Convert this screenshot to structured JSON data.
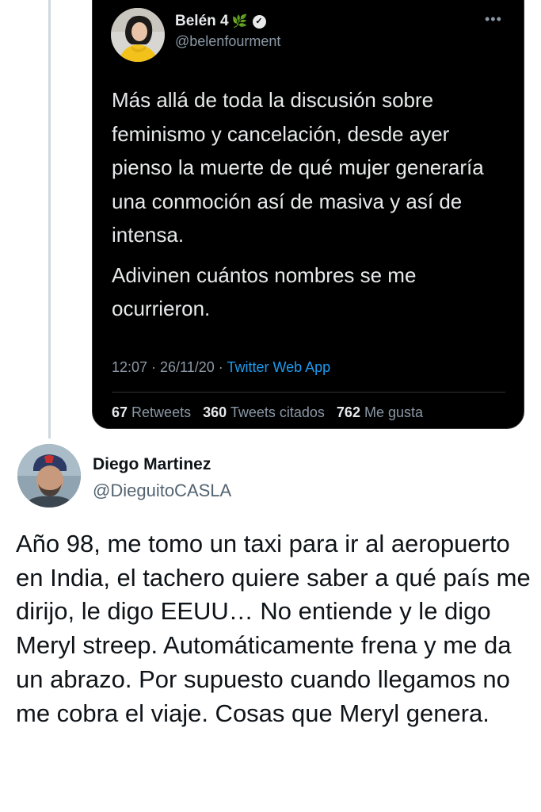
{
  "quoted_tweet": {
    "author_name": "Belén 4",
    "name_emoji": "🌿",
    "verified_icon": "verified-badge-icon",
    "handle": "@belenfourment",
    "more_icon": "•••",
    "paragraphs": [
      "Más allá de toda la discusión sobre feminismo y cancelación, desde ayer pienso la muerte de qué mujer generaría una conmoción así de masiva y así de intensa.",
      "Adivinen cuántos nombres se me ocurrieron."
    ],
    "time": "12:07 · 26/11/20 · ",
    "source": "Twitter Web App",
    "stats": {
      "retweets_count": "67",
      "retweets_label": "Retweets",
      "quotes_count": "360",
      "quotes_label": "Tweets citados",
      "likes_count": "762",
      "likes_label": "Me gusta"
    }
  },
  "tweet": {
    "author_name": "Diego Martinez",
    "handle": "@DieguitoCASLA",
    "text": "Año 98, me tomo un taxi para ir al aeropuerto en India, el tachero quiere saber a qué país me dirijo, le digo EEUU… No entiende y le digo Meryl streep. Automáticamente frena y me da un abrazo. Por supuesto cuando llegamos no me cobra el viaje. Cosas que Meryl genera."
  },
  "colors": {
    "card_bg": "#000000",
    "link_blue": "#1d9bf0",
    "thread_line": "#cfd9de"
  }
}
